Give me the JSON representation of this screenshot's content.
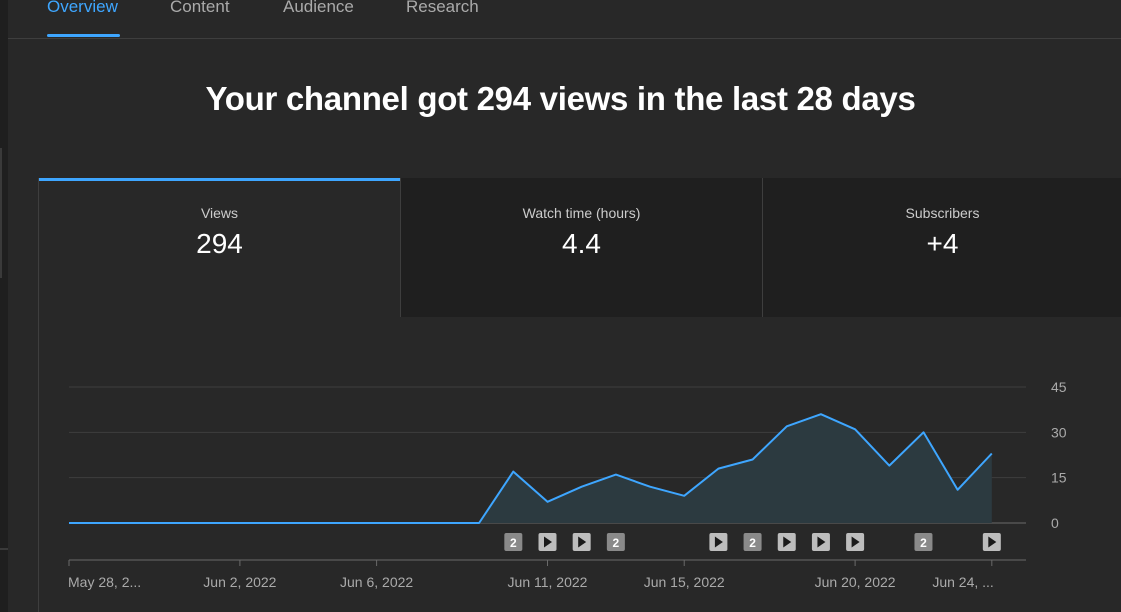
{
  "tabs": [
    {
      "label": "Overview",
      "active": true
    },
    {
      "label": "Content",
      "active": false
    },
    {
      "label": "Audience",
      "active": false
    },
    {
      "label": "Research",
      "active": false
    }
  ],
  "headline": "Your channel got 294 views in the last 28 days",
  "metrics": [
    {
      "label": "Views",
      "value": "294",
      "selected": true
    },
    {
      "label": "Watch time (hours)",
      "value": "4.4",
      "selected": false
    },
    {
      "label": "Subscribers",
      "value": "+4",
      "selected": false
    }
  ],
  "colors": {
    "accent": "#3ea6ff",
    "line": "#3ea6ff",
    "area_fill": "#2c3a40",
    "marker_bg": "#8a8a8a"
  },
  "chart_data": {
    "type": "area",
    "title": "",
    "xlabel": "",
    "ylabel": "",
    "x": [
      "May 28",
      "May 29",
      "May 30",
      "May 31",
      "Jun 1",
      "Jun 2",
      "Jun 3",
      "Jun 4",
      "Jun 5",
      "Jun 6",
      "Jun 7",
      "Jun 8",
      "Jun 9",
      "Jun 10",
      "Jun 11",
      "Jun 12",
      "Jun 13",
      "Jun 14",
      "Jun 15",
      "Jun 16",
      "Jun 17",
      "Jun 18",
      "Jun 19",
      "Jun 20",
      "Jun 21",
      "Jun 22",
      "Jun 23",
      "Jun 24",
      "Jun 25"
    ],
    "series": [
      {
        "values": [
          0,
          0,
          0,
          0,
          0,
          0,
          0,
          0,
          0,
          0,
          0,
          0,
          0,
          17,
          7,
          12,
          16,
          12,
          9,
          18,
          21,
          32,
          36,
          31,
          19,
          30,
          11,
          23
        ]
      }
    ],
    "ylim": [
      0,
      45
    ],
    "y_ticks": [
      "45",
      "30",
      "15",
      "0"
    ],
    "y_tick_values": [
      45,
      30,
      15,
      0
    ],
    "x_tick_labels": [
      "May 28, 2...",
      "Jun 2, 2022",
      "Jun 6, 2022",
      "Jun 11, 2022",
      "Jun 15, 2022",
      "Jun 20, 2022",
      "Jun 24, ..."
    ],
    "x_tick_index": [
      0,
      5,
      9,
      14,
      18,
      23,
      27
    ],
    "grid": true,
    "axis_position": "right",
    "markers": [
      {
        "day_index": 13,
        "kind": "count",
        "label": "2"
      },
      {
        "day_index": 14,
        "kind": "video",
        "label": ""
      },
      {
        "day_index": 15,
        "kind": "video",
        "label": ""
      },
      {
        "day_index": 16,
        "kind": "count",
        "label": "2"
      },
      {
        "day_index": 19,
        "kind": "video",
        "label": ""
      },
      {
        "day_index": 20,
        "kind": "count",
        "label": "2"
      },
      {
        "day_index": 21,
        "kind": "video",
        "label": ""
      },
      {
        "day_index": 22,
        "kind": "video",
        "label": ""
      },
      {
        "day_index": 23,
        "kind": "video",
        "label": ""
      },
      {
        "day_index": 25,
        "kind": "count",
        "label": "2"
      },
      {
        "day_index": 27,
        "kind": "video",
        "label": ""
      }
    ]
  }
}
